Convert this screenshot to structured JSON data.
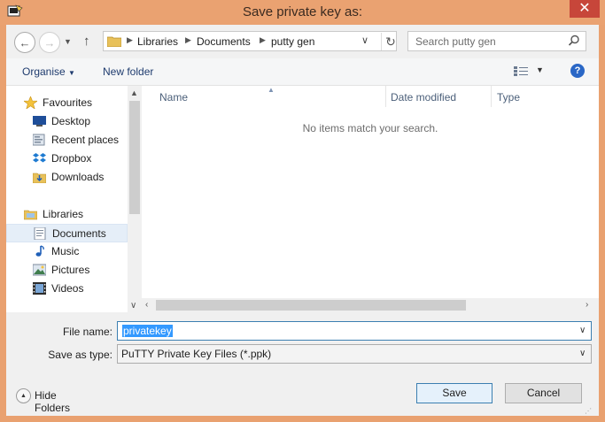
{
  "window": {
    "title": "Save private key as:",
    "close_label": "✕"
  },
  "address": {
    "crumbs": [
      "Libraries",
      "Documents",
      "putty gen"
    ]
  },
  "search": {
    "placeholder": "Search putty gen"
  },
  "toolbar": {
    "organise_label": "Organise",
    "new_folder_label": "New folder",
    "help_label": "?"
  },
  "nav": {
    "favourites": {
      "label": "Favourites",
      "items": [
        {
          "label": "Desktop",
          "icon": "desktop-icon"
        },
        {
          "label": "Recent places",
          "icon": "recent-places-icon"
        },
        {
          "label": "Dropbox",
          "icon": "dropbox-icon"
        },
        {
          "label": "Downloads",
          "icon": "downloads-icon"
        }
      ]
    },
    "libraries": {
      "label": "Libraries",
      "items": [
        {
          "label": "Documents",
          "icon": "documents-icon",
          "selected": true
        },
        {
          "label": "Music",
          "icon": "music-icon"
        },
        {
          "label": "Pictures",
          "icon": "pictures-icon"
        },
        {
          "label": "Videos",
          "icon": "videos-icon"
        }
      ]
    }
  },
  "files": {
    "columns": [
      "Name",
      "Date modified",
      "Type"
    ],
    "empty_message": "No items match your search."
  },
  "form": {
    "filename_label": "File name:",
    "filename_value": "privatekey",
    "type_label": "Save as type:",
    "type_value": "PuTTY Private Key Files (*.ppk)"
  },
  "footer": {
    "hide_folders_label": "Hide Folders",
    "save_label": "Save",
    "cancel_label": "Cancel"
  },
  "colors": {
    "titlebar": "#eaa271",
    "close": "#c7463a",
    "selection": "#3399ff",
    "link": "#1e3b6e"
  }
}
